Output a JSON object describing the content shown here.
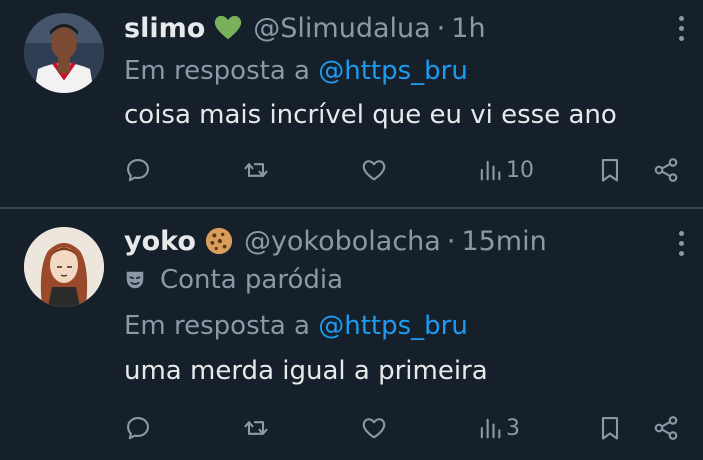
{
  "tweets": [
    {
      "name": "slimo",
      "name_emoji": "green-heart",
      "handle": "@Slimudalua",
      "separator": "·",
      "time": "1h",
      "reply_prefix": "Em resposta a",
      "reply_to": "@https_bru",
      "text": "coisa mais incrível que eu vi esse ano",
      "views": "10"
    },
    {
      "name": "yoko",
      "name_emoji": "cookie",
      "handle": "@yokobolacha",
      "separator": "·",
      "time": "15min",
      "parody_label": "Conta paródia",
      "reply_prefix": "Em resposta a",
      "reply_to": "@https_bru",
      "text": "uma merda igual a primeira",
      "views": "3"
    }
  ],
  "colors": {
    "background": "#15202b",
    "text": "#e7e9ea",
    "muted": "#8b98a5",
    "link": "#1d9bf0",
    "divider": "#38444d",
    "heart_emoji": "#78b159"
  }
}
